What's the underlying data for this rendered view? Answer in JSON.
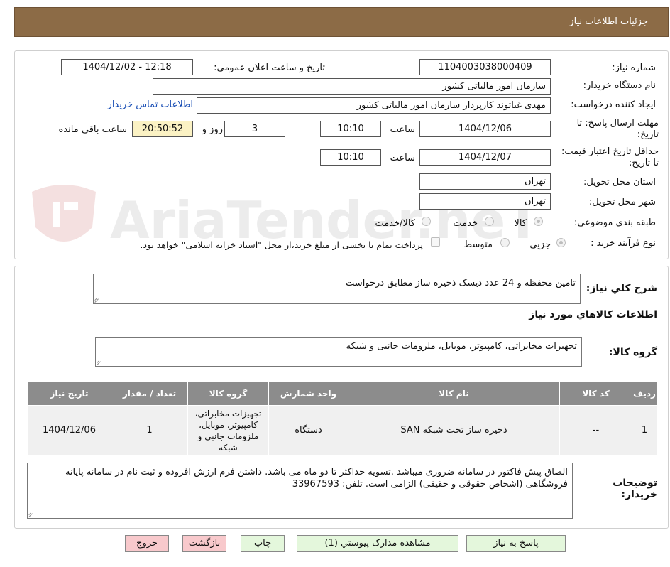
{
  "header": {
    "title": "جزئیات اطلاعات نیاز"
  },
  "watermark": {
    "text": "AriaTender.neT"
  },
  "form": {
    "need_number_label": "شماره نیاز:",
    "need_number": "1104003038000409",
    "announce_label": "تاریخ و ساعت اعلان عمومي:",
    "announce_value": "1404/12/02 - 12:18",
    "buyer_org_label": "نام دستگاه خريدار:",
    "buyer_org": "سازمان امور مالیاتی کشور",
    "creator_label": "ايجاد کننده درخواست:",
    "creator": "مهدی غیاثوند کارپرداز سازمان امور مالیاتی کشور",
    "contact_link": "اطلاعات تماس خريدار",
    "deadline_label": "مهلت ارسال پاسخ: تا تاریخ:",
    "deadline_date": "1404/12/06",
    "time_label": "ساعت",
    "deadline_time": "10:10",
    "days_value": "3",
    "days_label": "روز و",
    "remaining_time": "20:50:52",
    "remaining_label": "ساعت باقي مانده",
    "validity_label": "حداقل تاريخ اعتبار قيمت: تا تاريخ:",
    "validity_date": "1404/12/07",
    "validity_time": "10:10",
    "province_label": "استان محل تحويل:",
    "province": "تهران",
    "city_label": "شهر محل تحويل:",
    "city": "تهران",
    "category_label": "طبقه بندی موضوعی:",
    "category_options": [
      "کالا",
      "خدمت",
      "کالا/خدمت"
    ],
    "process_label": "نوع فرآيند خريد :",
    "process_options": [
      "جزيي",
      "متوسط"
    ],
    "payment_note": "پرداخت تمام يا بخشی از مبلغ خريد،از محل \"اسناد خزانه اسلامی\" خواهد بود."
  },
  "description": {
    "label": "شرح کلي نياز:",
    "value": "تامین محفظه و 24 عدد دیسک ذخیره ساز مطابق درخواست"
  },
  "goods_info": {
    "title": "اطلاعات کالاهاي مورد نياز"
  },
  "goods_group": {
    "label": "گروه کالا:",
    "value": "تجهیزات مخابراتی، کامپیوتر، موبایل، ملزومات جانبی و شبکه"
  },
  "table": {
    "headers": [
      "رديف",
      "کد کالا",
      "نام کالا",
      "واحد شمارش",
      "گروه کالا",
      "تعداد / مقدار",
      "تاريخ نياز"
    ],
    "rows": [
      [
        "1",
        "--",
        "ذخیره ساز تحت شبکه SAN",
        "دستگاه",
        "تجهیزات مخابراتی، کامپیوتر، موبایل، ملزومات جانبی و شبکه",
        "1",
        "1404/12/06"
      ]
    ]
  },
  "buyer_notes": {
    "label": "توضيحات خريدار:",
    "value": "الصاق پیش فاکتور در سامانه ضروری میباشد .تسویه حداکثر تا دو ماه می باشد.  داشتن فرم ارزش افزوده و ثبت نام در سامانه پایانه فروشگاهی (اشخاص حقوقی و حقیقی) الزامی است. تلفن:  33967593"
  },
  "buttons": {
    "reply": "پاسخ به نياز",
    "attachments": "مشاهده مدارک پيوستي (1)",
    "print": "چاپ",
    "back": "بازگشت",
    "exit": "خروج"
  },
  "colors": {
    "header_bg": "#8c6b46",
    "table_header_bg": "#8c8c8c",
    "button_green": "#e4f7dc",
    "button_pink": "#f8c9cc"
  }
}
